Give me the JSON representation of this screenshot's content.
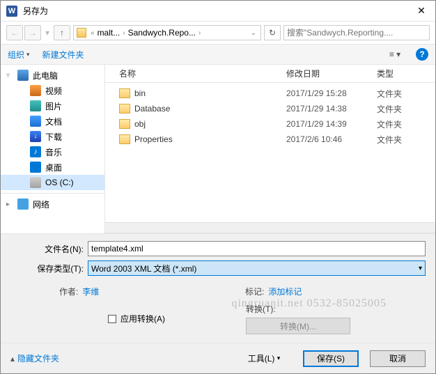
{
  "window": {
    "title": "另存为",
    "app_icon_letter": "W"
  },
  "nav": {
    "breadcrumb": {
      "item1": "malt...",
      "item2": "Sandwych.Repo..."
    },
    "search_placeholder": "搜索\"Sandwych.Reporting...."
  },
  "toolbar": {
    "organize": "组织",
    "new_folder": "新建文件夹"
  },
  "sidebar": {
    "this_pc": "此电脑",
    "video": "视频",
    "pictures": "图片",
    "documents": "文档",
    "downloads": "下载",
    "music": "音乐",
    "desktop": "桌面",
    "drive_c": "OS (C:)",
    "network": "网络"
  },
  "columns": {
    "name": "名称",
    "date": "修改日期",
    "type": "类型"
  },
  "files": [
    {
      "name": "bin",
      "date": "2017/1/29 15:28",
      "type": "文件夹"
    },
    {
      "name": "Database",
      "date": "2017/1/29 14:38",
      "type": "文件夹"
    },
    {
      "name": "obj",
      "date": "2017/1/29 14:39",
      "type": "文件夹"
    },
    {
      "name": "Properties",
      "date": "2017/2/6 10:46",
      "type": "文件夹"
    }
  ],
  "fields": {
    "filename_label": "文件名(N):",
    "filename_value": "template4.xml",
    "type_label": "保存类型(T):",
    "type_value": "Word 2003 XML 文档 (*.xml)"
  },
  "meta": {
    "author_label": "作者:",
    "author_value": "李维",
    "tags_label": "标记:",
    "tags_value": "添加标记",
    "apply_transform": "应用转换(A)",
    "transform_label": "转换(T):",
    "transform_btn": "转换(M)..."
  },
  "bottom": {
    "hide_folders": "隐藏文件夹",
    "tools": "工具(L)",
    "save": "保存(S)",
    "cancel": "取消"
  },
  "watermark": "qingruanit.net 0532-85025005"
}
